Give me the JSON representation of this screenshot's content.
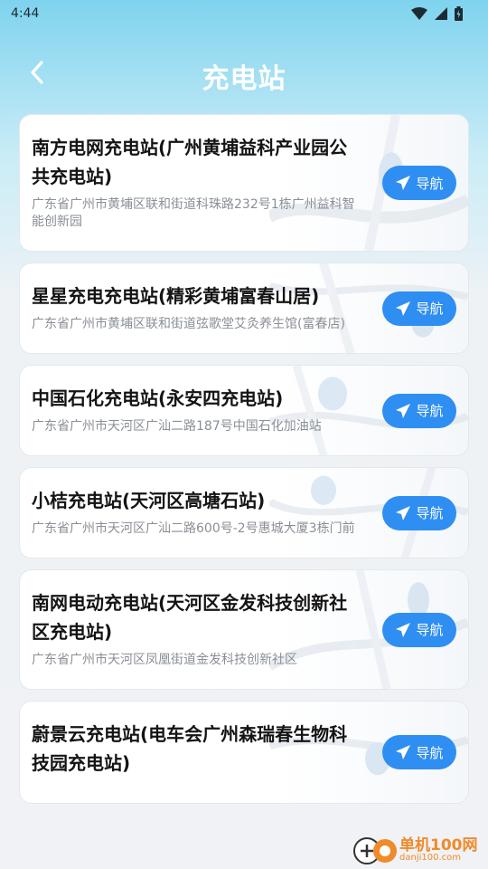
{
  "status_bar": {
    "time": "4:44"
  },
  "header": {
    "title": "充电站"
  },
  "stations": [
    {
      "name": "南方电网充电站(广州黄埔益科产业园公共充电站)",
      "address": "广东省广州市黄埔区联和街道科珠路232号1栋广州益科智能创新园",
      "nav_label": "导航"
    },
    {
      "name": "星星充电充电站(精彩黄埔富春山居)",
      "address": "广东省广州市黄埔区联和街道弦歌堂艾灸养生馆(富春店)",
      "nav_label": "导航"
    },
    {
      "name": "中国石化充电站(永安四充电站)",
      "address": "广东省广州市天河区广汕二路187号中国石化加油站",
      "nav_label": "导航"
    },
    {
      "name": "小桔充电站(天河区高塘石站)",
      "address": "广东省广州市天河区广汕二路600号-2号惠城大厦3栋门前",
      "nav_label": "导航"
    },
    {
      "name": "南网电动充电站(天河区金发科技创新社区充电站)",
      "address": "广东省广州市天河区凤凰街道金发科技创新社区",
      "nav_label": "导航"
    },
    {
      "name": "蔚景云充电站(电车会广州森瑞春生物科技园充电站)",
      "address": "",
      "nav_label": "导航"
    }
  ],
  "watermark": {
    "brand": "单机100网",
    "domain": "danji100.com"
  },
  "colors": {
    "accent": "#2f8ef2",
    "title": "#ffffff",
    "address": "#8a8f96"
  }
}
